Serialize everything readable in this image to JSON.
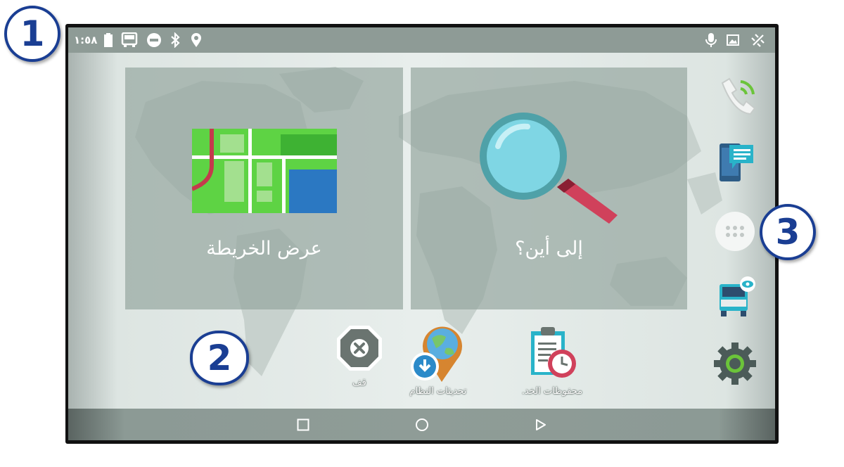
{
  "status_bar": {
    "time": "١:٥٨",
    "left_icons": [
      "battery-icon",
      "truck-mode-icon",
      "do-not-disturb-icon",
      "bluetooth-icon",
      "location-pin-icon"
    ],
    "right_icons": [
      "microphone-icon",
      "image-icon",
      "satellite-signal-icon"
    ]
  },
  "tiles": [
    {
      "label": "عرض الخريطة",
      "icon": "map-icon"
    },
    {
      "label": "إلى أين؟",
      "icon": "magnifier-icon"
    }
  ],
  "apps": [
    {
      "label": "محفوظات الخد.",
      "icon": "service-history-icon"
    },
    {
      "label": "تحديثات النظام",
      "icon": "system-updates-icon"
    },
    {
      "label": "قف",
      "icon": "stop-icon"
    }
  ],
  "side_icons": [
    "phone-call-icon",
    "messages-icon",
    "app-drawer-icon",
    "truck-view-icon",
    "settings-gear-icon"
  ],
  "nav_bar": [
    "back-icon",
    "home-icon",
    "recent-apps-icon"
  ],
  "callouts": [
    "1",
    "2",
    "3"
  ],
  "colors": {
    "status_bar": "#8e9b96",
    "map_green": "#5ed344",
    "map_blue": "#2b78c2",
    "callout_blue": "#1a3e93"
  }
}
